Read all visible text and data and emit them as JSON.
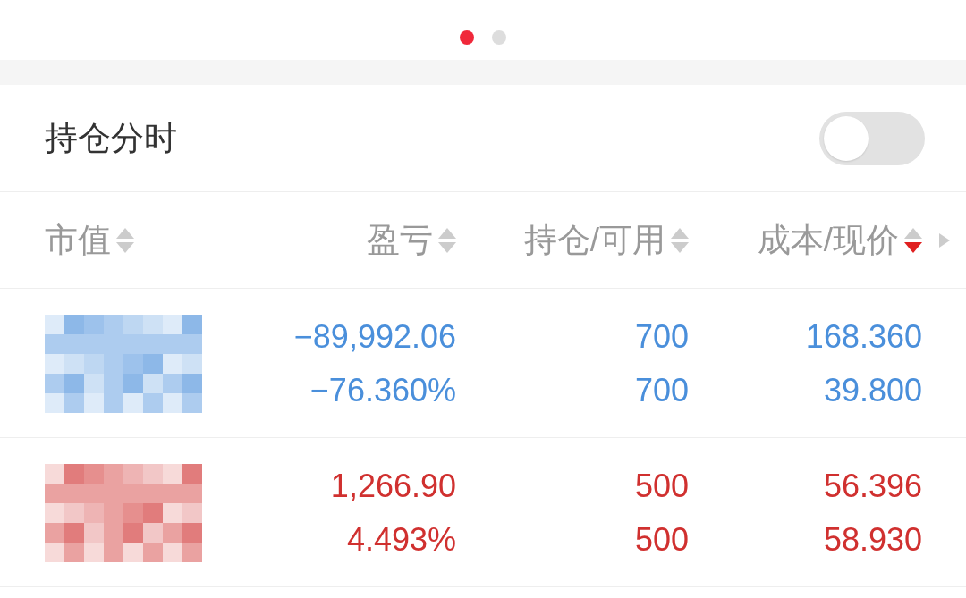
{
  "page_indicator": [
    {
      "selected": true
    },
    {
      "selected": false
    }
  ],
  "position_time": {
    "label": "持仓分时",
    "on": false
  },
  "columns": [
    {
      "label": "市值",
      "sorted_descending": false
    },
    {
      "label": "盈亏",
      "sorted_descending": false
    },
    {
      "label": "持仓/可用",
      "sorted_descending": false
    },
    {
      "label": "成本/现价",
      "sorted_descending": true
    }
  ],
  "rows": [
    {
      "kind": "loss",
      "profit_loss": "−89,992.06",
      "profit_loss_pct": "−76.360%",
      "holding": "700",
      "available": "700",
      "cost": "168.360",
      "price": "39.800"
    },
    {
      "kind": "gain",
      "profit_loss": "1,266.90",
      "profit_loss_pct": "4.493%",
      "holding": "500",
      "available": "500",
      "cost": "56.396",
      "price": "58.930"
    }
  ]
}
